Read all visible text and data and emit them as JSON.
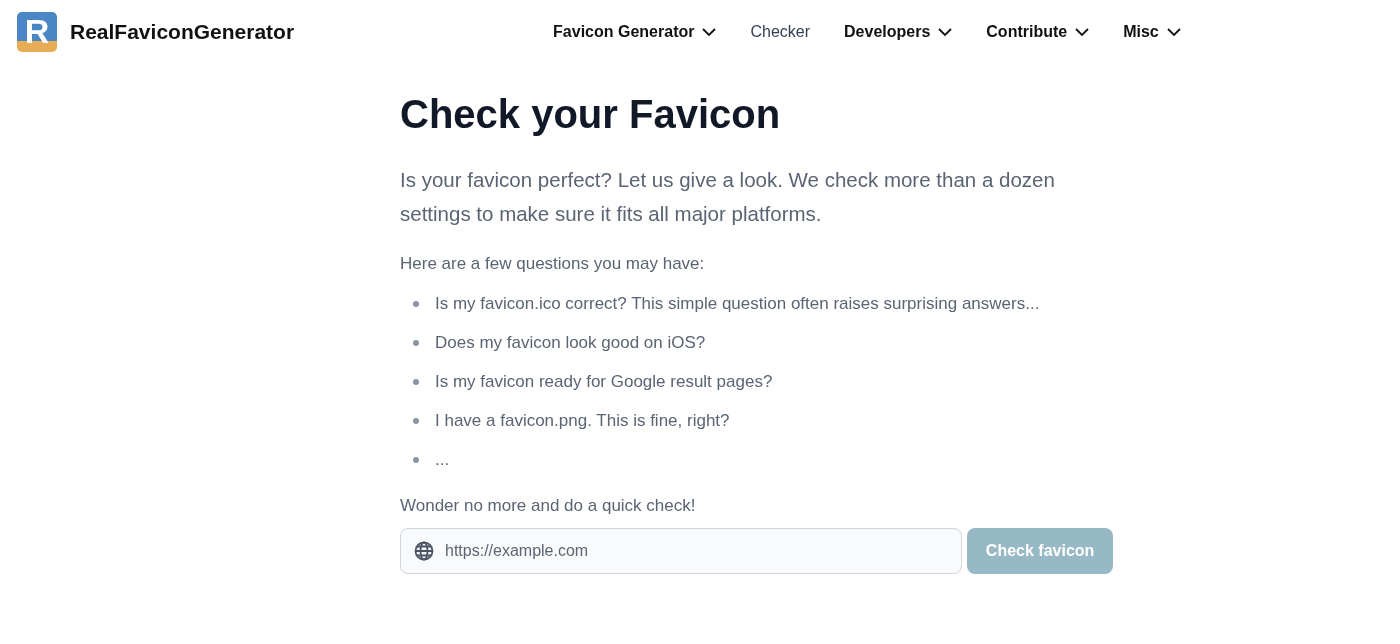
{
  "header": {
    "logo_letter": "R",
    "brand": "RealFaviconGenerator",
    "nav": [
      {
        "label": "Favicon Generator",
        "dropdown": true,
        "selected": false
      },
      {
        "label": "Checker",
        "dropdown": false,
        "selected": true
      },
      {
        "label": "Developers",
        "dropdown": true,
        "selected": false
      },
      {
        "label": "Contribute",
        "dropdown": true,
        "selected": false
      },
      {
        "label": "Misc",
        "dropdown": true,
        "selected": false
      }
    ]
  },
  "title": "Check your Favicon",
  "lead": "Is your favicon perfect? Let us give a look. We check more than a dozen settings to make sure it fits all major platforms.",
  "intro": "Here are a few questions you may have:",
  "questions": [
    "Is my favicon.ico correct? This simple question often raises surprising answers...",
    "Does my favicon look good on iOS?",
    "Is my favicon ready for Google result pages?",
    "I have a favicon.png. This is fine, right?",
    "..."
  ],
  "outro": "Wonder no more and do a quick check!",
  "form": {
    "placeholder": "https://example.com",
    "button": "Check favicon",
    "disabled": true
  }
}
